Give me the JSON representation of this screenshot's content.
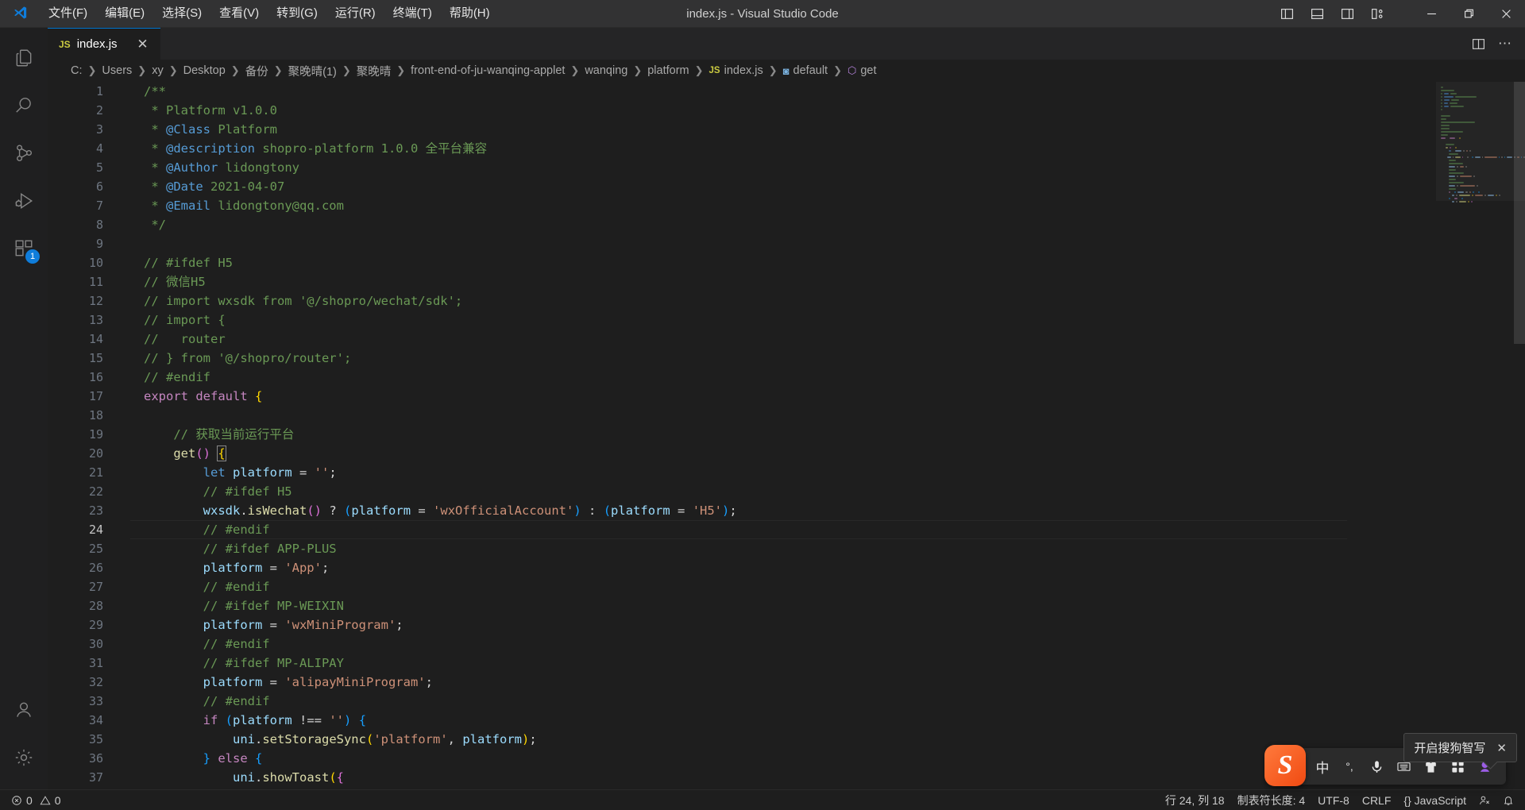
{
  "window": {
    "title": "index.js - Visual Studio Code",
    "menus": [
      "文件(F)",
      "编辑(E)",
      "选择(S)",
      "查看(V)",
      "转到(G)",
      "运行(R)",
      "终端(T)",
      "帮助(H)"
    ],
    "layout_icons": [
      "toggle-primary-sidebar-icon",
      "toggle-panel-icon",
      "toggle-secondary-sidebar-icon",
      "customize-layout-icon"
    ],
    "controls": {
      "minimize": "—",
      "maximize": "❐",
      "close": "✕"
    }
  },
  "activitybar": {
    "items": [
      {
        "name": "explorer",
        "icon": "files-icon",
        "badge": ""
      },
      {
        "name": "search",
        "icon": "search-icon",
        "badge": ""
      },
      {
        "name": "source-control",
        "icon": "source-control-icon",
        "badge": ""
      },
      {
        "name": "run-and-debug",
        "icon": "run-debug-icon",
        "badge": ""
      },
      {
        "name": "extensions",
        "icon": "extensions-icon",
        "badge": "1"
      }
    ],
    "bottom": [
      {
        "name": "accounts",
        "icon": "account-icon"
      },
      {
        "name": "manage",
        "icon": "gear-icon"
      }
    ]
  },
  "tabs": [
    {
      "label": "index.js",
      "icon": "js-file-icon",
      "active": true,
      "close": "✕"
    }
  ],
  "editor_actions": [
    "split-editor-icon",
    "more-actions-icon"
  ],
  "breadcrumb": [
    {
      "text": "C:",
      "type": "path"
    },
    {
      "text": "Users",
      "type": "path"
    },
    {
      "text": "xy",
      "type": "path"
    },
    {
      "text": "Desktop",
      "type": "path"
    },
    {
      "text": "备份",
      "type": "path"
    },
    {
      "text": "聚晚晴(1)",
      "type": "path"
    },
    {
      "text": "聚晚晴",
      "type": "path"
    },
    {
      "text": "front-end-of-ju-wanqing-applet",
      "type": "path"
    },
    {
      "text": "wanqing",
      "type": "path"
    },
    {
      "text": "platform",
      "type": "path"
    },
    {
      "text": "index.js",
      "type": "file",
      "icon": "JS"
    },
    {
      "text": "default",
      "type": "symbol-module",
      "icon": "◙"
    },
    {
      "text": "get",
      "type": "symbol-method",
      "icon": "⬡"
    }
  ],
  "code": {
    "active_line": 24,
    "lines": [
      {
        "n": 1,
        "tokens": [
          {
            "t": "/**",
            "c": "c"
          }
        ]
      },
      {
        "n": 2,
        "tokens": [
          {
            "t": " * Platform v1.0.0",
            "c": "c"
          }
        ]
      },
      {
        "n": 3,
        "tokens": [
          {
            "t": " * ",
            "c": "c"
          },
          {
            "t": "@Class",
            "c": "tag"
          },
          {
            "t": " Platform",
            "c": "c"
          }
        ]
      },
      {
        "n": 4,
        "tokens": [
          {
            "t": " * ",
            "c": "c"
          },
          {
            "t": "@description",
            "c": "tag"
          },
          {
            "t": " shopro-platform 1.0.0 全平台兼容",
            "c": "c"
          }
        ]
      },
      {
        "n": 5,
        "tokens": [
          {
            "t": " * ",
            "c": "c"
          },
          {
            "t": "@Author",
            "c": "tag"
          },
          {
            "t": " lidongtony",
            "c": "c"
          }
        ]
      },
      {
        "n": 6,
        "tokens": [
          {
            "t": " * ",
            "c": "c"
          },
          {
            "t": "@Date",
            "c": "tag"
          },
          {
            "t": " 2021-04-07",
            "c": "c"
          }
        ]
      },
      {
        "n": 7,
        "tokens": [
          {
            "t": " * ",
            "c": "c"
          },
          {
            "t": "@Email",
            "c": "tag"
          },
          {
            "t": " lidongtony@qq.com",
            "c": "c"
          }
        ]
      },
      {
        "n": 8,
        "tokens": [
          {
            "t": " */",
            "c": "c"
          }
        ]
      },
      {
        "n": 9,
        "tokens": []
      },
      {
        "n": 10,
        "tokens": [
          {
            "t": "// #ifdef H5",
            "c": "c"
          }
        ]
      },
      {
        "n": 11,
        "tokens": [
          {
            "t": "// 微信H5",
            "c": "c"
          }
        ]
      },
      {
        "n": 12,
        "tokens": [
          {
            "t": "// import wxsdk from '@/shopro/wechat/sdk';",
            "c": "c"
          }
        ]
      },
      {
        "n": 13,
        "tokens": [
          {
            "t": "// import {",
            "c": "c"
          }
        ]
      },
      {
        "n": 14,
        "tokens": [
          {
            "t": "//   router",
            "c": "c"
          }
        ]
      },
      {
        "n": 15,
        "tokens": [
          {
            "t": "// } from '@/shopro/router';",
            "c": "c"
          }
        ]
      },
      {
        "n": 16,
        "tokens": [
          {
            "t": "// #endif",
            "c": "c"
          }
        ]
      },
      {
        "n": 17,
        "tokens": [
          {
            "t": "export",
            "c": "kw"
          },
          {
            "t": " ",
            "c": "pl"
          },
          {
            "t": "default",
            "c": "kw"
          },
          {
            "t": " ",
            "c": "pl"
          },
          {
            "t": "{",
            "c": "brk1"
          }
        ]
      },
      {
        "n": 18,
        "tokens": []
      },
      {
        "n": 19,
        "tokens": [
          {
            "t": "    ",
            "c": "pl"
          },
          {
            "t": "// 获取当前运行平台",
            "c": "c"
          }
        ]
      },
      {
        "n": 20,
        "tokens": [
          {
            "t": "    ",
            "c": "pl"
          },
          {
            "t": "get",
            "c": "fn"
          },
          {
            "t": "()",
            "c": "brk2"
          },
          {
            "t": " ",
            "c": "pl"
          },
          {
            "t": "{",
            "c": "brk1",
            "cursor": true
          }
        ]
      },
      {
        "n": 21,
        "tokens": [
          {
            "t": "        ",
            "c": "pl"
          },
          {
            "t": "let",
            "c": "kw2"
          },
          {
            "t": " ",
            "c": "pl"
          },
          {
            "t": "platform",
            "c": "var"
          },
          {
            "t": " = ",
            "c": "op"
          },
          {
            "t": "''",
            "c": "str"
          },
          {
            "t": ";",
            "c": "op"
          }
        ]
      },
      {
        "n": 22,
        "tokens": [
          {
            "t": "        ",
            "c": "pl"
          },
          {
            "t": "// #ifdef H5",
            "c": "c"
          }
        ]
      },
      {
        "n": 23,
        "tokens": [
          {
            "t": "        ",
            "c": "pl"
          },
          {
            "t": "wxsdk",
            "c": "var"
          },
          {
            "t": ".",
            "c": "op"
          },
          {
            "t": "isWechat",
            "c": "fn"
          },
          {
            "t": "()",
            "c": "brk2"
          },
          {
            "t": " ",
            "c": "pl"
          },
          {
            "t": "?",
            "c": "op"
          },
          {
            "t": " ",
            "c": "pl"
          },
          {
            "t": "(",
            "c": "brk3"
          },
          {
            "t": "platform",
            "c": "var"
          },
          {
            "t": " = ",
            "c": "op"
          },
          {
            "t": "'wxOfficialAccount'",
            "c": "str"
          },
          {
            "t": ")",
            "c": "brk3"
          },
          {
            "t": " : ",
            "c": "op"
          },
          {
            "t": "(",
            "c": "brk3"
          },
          {
            "t": "platform",
            "c": "var"
          },
          {
            "t": " = ",
            "c": "op"
          },
          {
            "t": "'H5'",
            "c": "str"
          },
          {
            "t": ")",
            "c": "brk3"
          },
          {
            "t": ";",
            "c": "op"
          }
        ]
      },
      {
        "n": 24,
        "tokens": [
          {
            "t": "        ",
            "c": "pl"
          },
          {
            "t": "// #endif",
            "c": "c"
          }
        ]
      },
      {
        "n": 25,
        "tokens": [
          {
            "t": "        ",
            "c": "pl"
          },
          {
            "t": "// #ifdef APP-PLUS",
            "c": "c"
          }
        ]
      },
      {
        "n": 26,
        "tokens": [
          {
            "t": "        ",
            "c": "pl"
          },
          {
            "t": "platform",
            "c": "var"
          },
          {
            "t": " = ",
            "c": "op"
          },
          {
            "t": "'App'",
            "c": "str"
          },
          {
            "t": ";",
            "c": "op"
          }
        ]
      },
      {
        "n": 27,
        "tokens": [
          {
            "t": "        ",
            "c": "pl"
          },
          {
            "t": "// #endif",
            "c": "c"
          }
        ]
      },
      {
        "n": 28,
        "tokens": [
          {
            "t": "        ",
            "c": "pl"
          },
          {
            "t": "// #ifdef MP-WEIXIN",
            "c": "c"
          }
        ]
      },
      {
        "n": 29,
        "tokens": [
          {
            "t": "        ",
            "c": "pl"
          },
          {
            "t": "platform",
            "c": "var"
          },
          {
            "t": " = ",
            "c": "op"
          },
          {
            "t": "'wxMiniProgram'",
            "c": "str"
          },
          {
            "t": ";",
            "c": "op"
          }
        ]
      },
      {
        "n": 30,
        "tokens": [
          {
            "t": "        ",
            "c": "pl"
          },
          {
            "t": "// #endif",
            "c": "c"
          }
        ]
      },
      {
        "n": 31,
        "tokens": [
          {
            "t": "        ",
            "c": "pl"
          },
          {
            "t": "// #ifdef MP-ALIPAY",
            "c": "c"
          }
        ]
      },
      {
        "n": 32,
        "tokens": [
          {
            "t": "        ",
            "c": "pl"
          },
          {
            "t": "platform",
            "c": "var"
          },
          {
            "t": " = ",
            "c": "op"
          },
          {
            "t": "'alipayMiniProgram'",
            "c": "str"
          },
          {
            "t": ";",
            "c": "op"
          }
        ]
      },
      {
        "n": 33,
        "tokens": [
          {
            "t": "        ",
            "c": "pl"
          },
          {
            "t": "// #endif",
            "c": "c"
          }
        ]
      },
      {
        "n": 34,
        "tokens": [
          {
            "t": "        ",
            "c": "pl"
          },
          {
            "t": "if",
            "c": "kw"
          },
          {
            "t": " ",
            "c": "pl"
          },
          {
            "t": "(",
            "c": "brk3"
          },
          {
            "t": "platform",
            "c": "var"
          },
          {
            "t": " !== ",
            "c": "op"
          },
          {
            "t": "''",
            "c": "str"
          },
          {
            "t": ")",
            "c": "brk3"
          },
          {
            "t": " ",
            "c": "pl"
          },
          {
            "t": "{",
            "c": "brk3"
          }
        ]
      },
      {
        "n": 35,
        "tokens": [
          {
            "t": "            ",
            "c": "pl"
          },
          {
            "t": "uni",
            "c": "var"
          },
          {
            "t": ".",
            "c": "op"
          },
          {
            "t": "setStorageSync",
            "c": "fn"
          },
          {
            "t": "(",
            "c": "brk1"
          },
          {
            "t": "'platform'",
            "c": "str"
          },
          {
            "t": ", ",
            "c": "op"
          },
          {
            "t": "platform",
            "c": "var"
          },
          {
            "t": ")",
            "c": "brk1"
          },
          {
            "t": ";",
            "c": "op"
          }
        ]
      },
      {
        "n": 36,
        "tokens": [
          {
            "t": "        ",
            "c": "pl"
          },
          {
            "t": "}",
            "c": "brk3"
          },
          {
            "t": " ",
            "c": "pl"
          },
          {
            "t": "else",
            "c": "kw"
          },
          {
            "t": " ",
            "c": "pl"
          },
          {
            "t": "{",
            "c": "brk3"
          }
        ]
      },
      {
        "n": 37,
        "tokens": [
          {
            "t": "            ",
            "c": "pl"
          },
          {
            "t": "uni",
            "c": "var"
          },
          {
            "t": ".",
            "c": "op"
          },
          {
            "t": "showToast",
            "c": "fn"
          },
          {
            "t": "(",
            "c": "brk1"
          },
          {
            "t": "{",
            "c": "brk2"
          }
        ]
      }
    ]
  },
  "statusbar": {
    "left": [
      {
        "name": "problems",
        "icon": "error-warning-icon",
        "text": "0  0",
        "errors": "0",
        "warnings": "0"
      }
    ],
    "right": [
      {
        "name": "editor-position",
        "text": "行 24, 列 18"
      },
      {
        "name": "indentation",
        "text": "制表符长度: 4"
      },
      {
        "name": "encoding",
        "text": "UTF-8"
      },
      {
        "name": "eol",
        "text": "CRLF"
      },
      {
        "name": "language-mode",
        "text": "{} JavaScript"
      },
      {
        "name": "remote-feedback",
        "text": ""
      },
      {
        "name": "notifications",
        "text": ""
      }
    ]
  },
  "ime": {
    "tooltip": "开启搜狗智写",
    "tooltip_close": "✕",
    "logo": "S",
    "buttons": [
      "中",
      "°,",
      "mic-icon",
      "keyboard-icon",
      "skin-icon",
      "apps-grid-icon",
      "smart-write-icon"
    ]
  },
  "colors": {
    "accent": "#0078d4",
    "badge": "#0f7ddb",
    "editor_bg": "#1e1e1e",
    "titlebar_bg": "#323233",
    "activitybar_bg": "#1f1f20",
    "tabbar_bg": "#252526",
    "comment": "#6a9955",
    "string": "#ce9178",
    "keyword": "#c586c0",
    "function": "#dcdcaa",
    "variable": "#9cdcfe",
    "js_yellow": "#cbcb41"
  }
}
